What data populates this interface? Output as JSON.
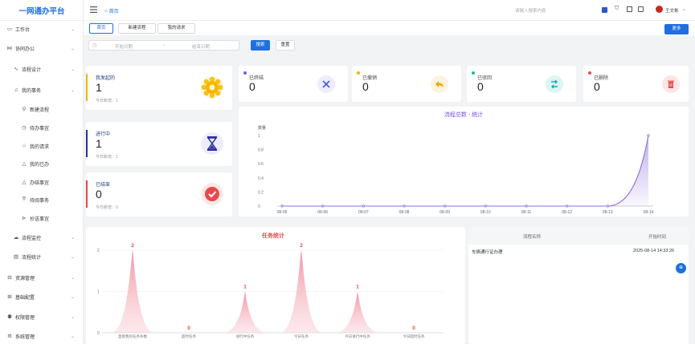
{
  "app_title": "一网通办平台",
  "header": {
    "breadcrumb_home": "首页",
    "search_placeholder": "请输入搜索内容",
    "username": "王文彬"
  },
  "tabs": [
    {
      "label": "首页",
      "active": true
    },
    {
      "label": "新建流程",
      "active": false
    },
    {
      "label": "我的请求",
      "active": false
    }
  ],
  "more_button": "更多",
  "filter": {
    "start_placeholder": "开始日期",
    "separator": "-",
    "end_placeholder": "结束日期",
    "search_button": "搜索",
    "reset_button": "重置"
  },
  "sidebar": {
    "items": [
      {
        "label": "工作台",
        "icon": "monitor-icon"
      },
      {
        "label": "协同办公",
        "icon": "share-icon"
      },
      {
        "label": "流程设计",
        "icon": "flow-icon"
      },
      {
        "label": "我的事务",
        "icon": "bell-icon"
      },
      {
        "label": "新建流程",
        "icon": "link-icon"
      },
      {
        "label": "待办事宜",
        "icon": "clock-icon"
      },
      {
        "label": "我的请求",
        "icon": "star-icon"
      },
      {
        "label": "我的已办",
        "icon": "triangle-icon"
      },
      {
        "label": "办结事宜",
        "icon": "triangle-icon"
      },
      {
        "label": "待阅事务",
        "icon": "filter-icon"
      },
      {
        "label": "抄送事宜",
        "icon": "send-icon"
      },
      {
        "label": "流程监控",
        "icon": "cloud-icon"
      },
      {
        "label": "流程统计",
        "icon": "chart-icon"
      },
      {
        "label": "资源管理",
        "icon": "box-icon"
      },
      {
        "label": "基础配置",
        "icon": "grid-icon"
      },
      {
        "label": "权限管理",
        "icon": "user-icon"
      },
      {
        "label": "系统管理",
        "icon": "gear-icon"
      }
    ]
  },
  "stats_main": [
    {
      "title": "我发起的",
      "value": "1",
      "sub": "今日新增：1",
      "accent": "#f5b400",
      "icon": "gear-icon"
    },
    {
      "title": "进行中",
      "value": "1",
      "sub": "今日新增：1",
      "accent": "#2b2f9e",
      "icon": "hourglass-icon"
    },
    {
      "title": "已结束",
      "value": "0",
      "sub": "今日新增：0",
      "accent": "#e64a4a",
      "icon": "check-circle-icon"
    }
  ],
  "stats_small": [
    {
      "title": "已终结",
      "value": "0",
      "dot": "#5b6af0",
      "icon": "close-icon",
      "icon_bg": "#eceefe",
      "icon_color": "#4a5ae8"
    },
    {
      "title": "已撤销",
      "value": "0",
      "dot": "#f5b400",
      "icon": "undo-icon",
      "icon_bg": "#fdf3de",
      "icon_color": "#f0a800"
    },
    {
      "title": "已驳回",
      "value": "0",
      "dot": "#16b9b3",
      "icon": "return-icon",
      "icon_bg": "#ddf5f4",
      "icon_color": "#13b0aa"
    },
    {
      "title": "已删除",
      "value": "0",
      "dot": "#e64a4a",
      "icon": "trash-icon",
      "icon_bg": "#fde5e5",
      "icon_color": "#e64a4a"
    }
  ],
  "line_chart": {
    "chart_data": {
      "type": "area",
      "title": "流程总数 - 统计",
      "ylabel": "数量",
      "categories": [
        "08-05",
        "08-06",
        "08-07",
        "08-08",
        "08-09",
        "08-10",
        "08-11",
        "08-12",
        "08-13",
        "08-14"
      ],
      "values": [
        0,
        0,
        0,
        0,
        0,
        0,
        0,
        0,
        0,
        1
      ],
      "ylim": [
        0,
        1
      ],
      "yticks": [
        "0",
        "0.2",
        "0.4",
        "0.6",
        "0.8",
        "1"
      ],
      "color": "#8b6fe0"
    }
  },
  "task_chart": {
    "chart_data": {
      "type": "area",
      "title": "任务统计",
      "categories": [
        "直接我的任务条数",
        "超时任务",
        "进行中任务",
        "今日任务",
        "今日进行中任务",
        "今日超时任务"
      ],
      "values": [
        2,
        0,
        1,
        2,
        1,
        0
      ],
      "ylim": [
        0,
        2
      ],
      "yticks": [
        "0",
        "1",
        "2"
      ],
      "color": "#f08a9a"
    }
  },
  "table": {
    "headers": [
      "流程名称",
      "开始时间"
    ],
    "rows": [
      [
        "车辆通行证办理",
        "2025-08-14 14:33:26"
      ]
    ]
  }
}
